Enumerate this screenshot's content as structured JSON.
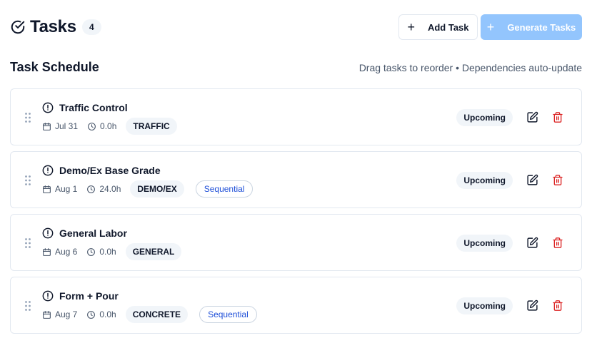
{
  "header": {
    "title": "Tasks",
    "count": "4",
    "add_label": "Add Task",
    "generate_label": "Generate Tasks"
  },
  "section": {
    "title": "Task Schedule",
    "hint": "Drag tasks to reorder • Dependencies auto-update"
  },
  "tasks": [
    {
      "name": "Traffic Control",
      "date": "Jul 31",
      "hours": "0.0h",
      "tag": "TRAFFIC",
      "sequential": "",
      "status": "Upcoming"
    },
    {
      "name": "Demo/Ex Base Grade",
      "date": "Aug 1",
      "hours": "24.0h",
      "tag": "DEMO/EX",
      "sequential": "Sequential",
      "status": "Upcoming"
    },
    {
      "name": "General Labor",
      "date": "Aug 6",
      "hours": "0.0h",
      "tag": "GENERAL",
      "sequential": "",
      "status": "Upcoming"
    },
    {
      "name": "Form + Pour",
      "date": "Aug 7",
      "hours": "0.0h",
      "tag": "CONCRETE",
      "sequential": "Sequential",
      "status": "Upcoming"
    }
  ],
  "icons": {
    "title": "check-circle-icon",
    "drag": "grip-vertical-icon",
    "alert": "alert-circle-icon",
    "date": "calendar-icon",
    "hours": "clock-icon",
    "edit": "edit-icon",
    "delete": "trash-icon"
  },
  "colors": {
    "primary_disabled": "#93c5fd",
    "delete": "#dc2626",
    "sequential_text": "#1d4ed8",
    "badge_bg": "#f1f5f9"
  }
}
